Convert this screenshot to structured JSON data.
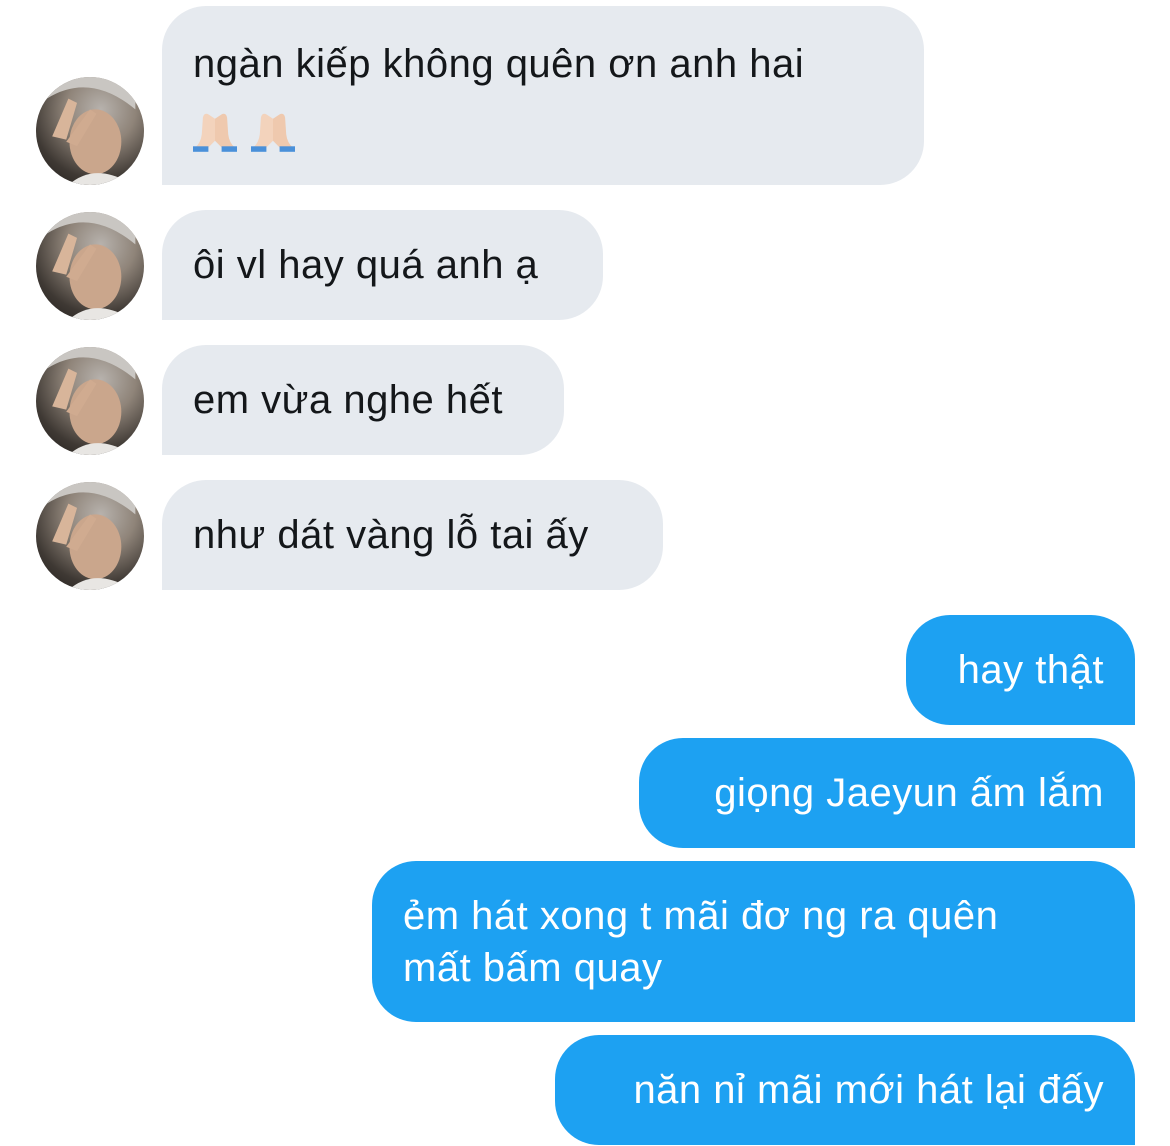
{
  "incoming": [
    {
      "text": "ngàn kiếp không quên ơn anh hai",
      "emoji": [
        "folded-hands-icon",
        "folded-hands-icon"
      ]
    },
    {
      "text": "ôi vl hay quá anh ạ"
    },
    {
      "text": "em vừa nghe hết"
    },
    {
      "text": "như dát vàng lỗ tai ấy"
    }
  ],
  "outgoing": [
    {
      "text": "hay thật"
    },
    {
      "text": "giọng Jaeyun ấm lắm"
    },
    {
      "line1": "ẻm hát xong t mãi đơ ng ra quên",
      "line2": "mất bấm quay"
    },
    {
      "text": "năn nỉ mãi mới hát lại đấy"
    }
  ],
  "colors": {
    "incoming_bubble": "#e6eaef",
    "incoming_text": "#14171a",
    "outgoing_bubble": "#1da1f2",
    "outgoing_text": "#ffffff"
  }
}
